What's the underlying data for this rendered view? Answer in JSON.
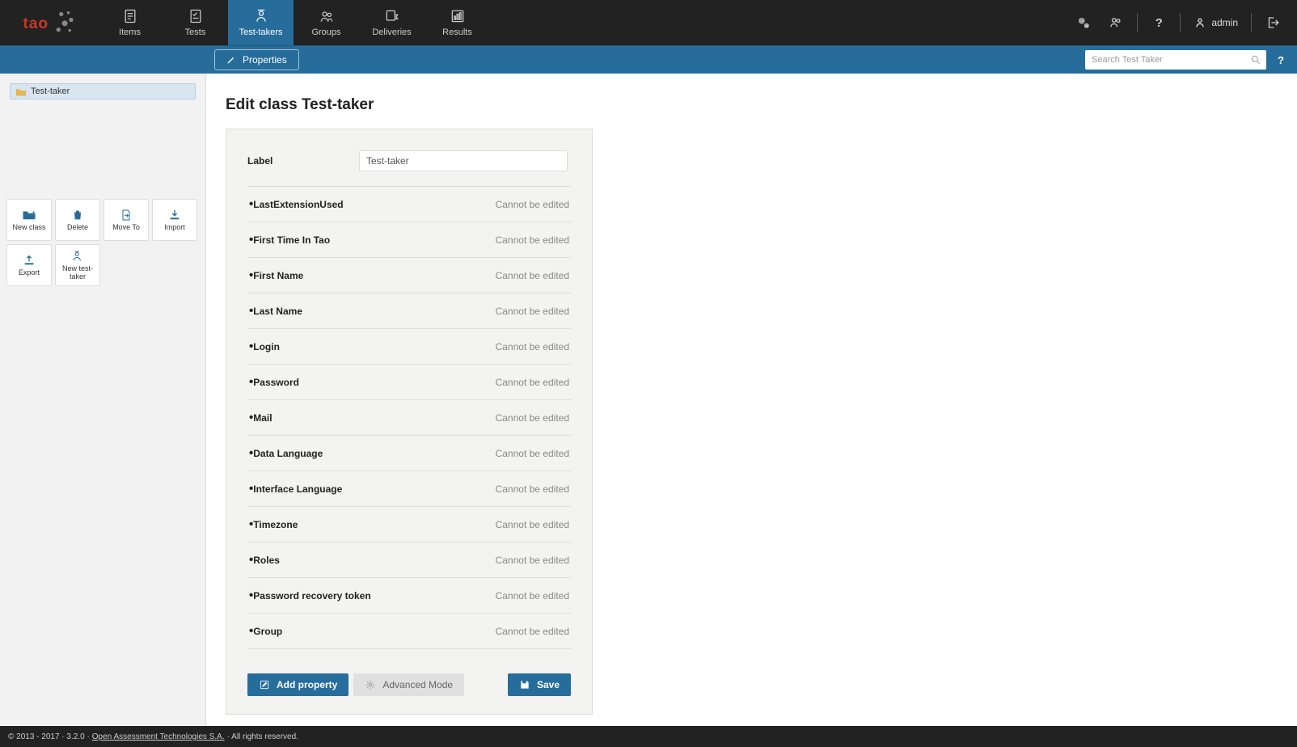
{
  "nav": {
    "items": [
      "Items",
      "Tests",
      "Test-takers",
      "Groups",
      "Deliveries",
      "Results"
    ],
    "activeIndex": 2,
    "user": "admin"
  },
  "bluebar": {
    "properties_label": "Properties",
    "search_placeholder": "Search Test Taker"
  },
  "sidebar": {
    "tree_item": "Test-taker",
    "actions": [
      "New class",
      "Delete",
      "Move To",
      "Import",
      "Export",
      "New test-taker"
    ]
  },
  "page": {
    "title": "Edit class Test-taker",
    "label_field": "Label",
    "label_value": "Test-taker",
    "cannot_edit": "Cannot be edited",
    "properties": [
      "LastExtensionUsed",
      "First Time In Tao",
      "First Name",
      "Last Name",
      "Login",
      "Password",
      "Mail",
      "Data Language",
      "Interface Language",
      "Timezone",
      "Roles",
      "Password recovery token",
      "Group"
    ],
    "add_property": "Add property",
    "advanced_mode": "Advanced Mode",
    "save": "Save"
  },
  "footer": {
    "copyright": "© 2013 - 2017 ·",
    "version": "3.2.0 ·",
    "vendor": "Open Assessment Technologies S.A.",
    "rights": "· All rights reserved."
  }
}
